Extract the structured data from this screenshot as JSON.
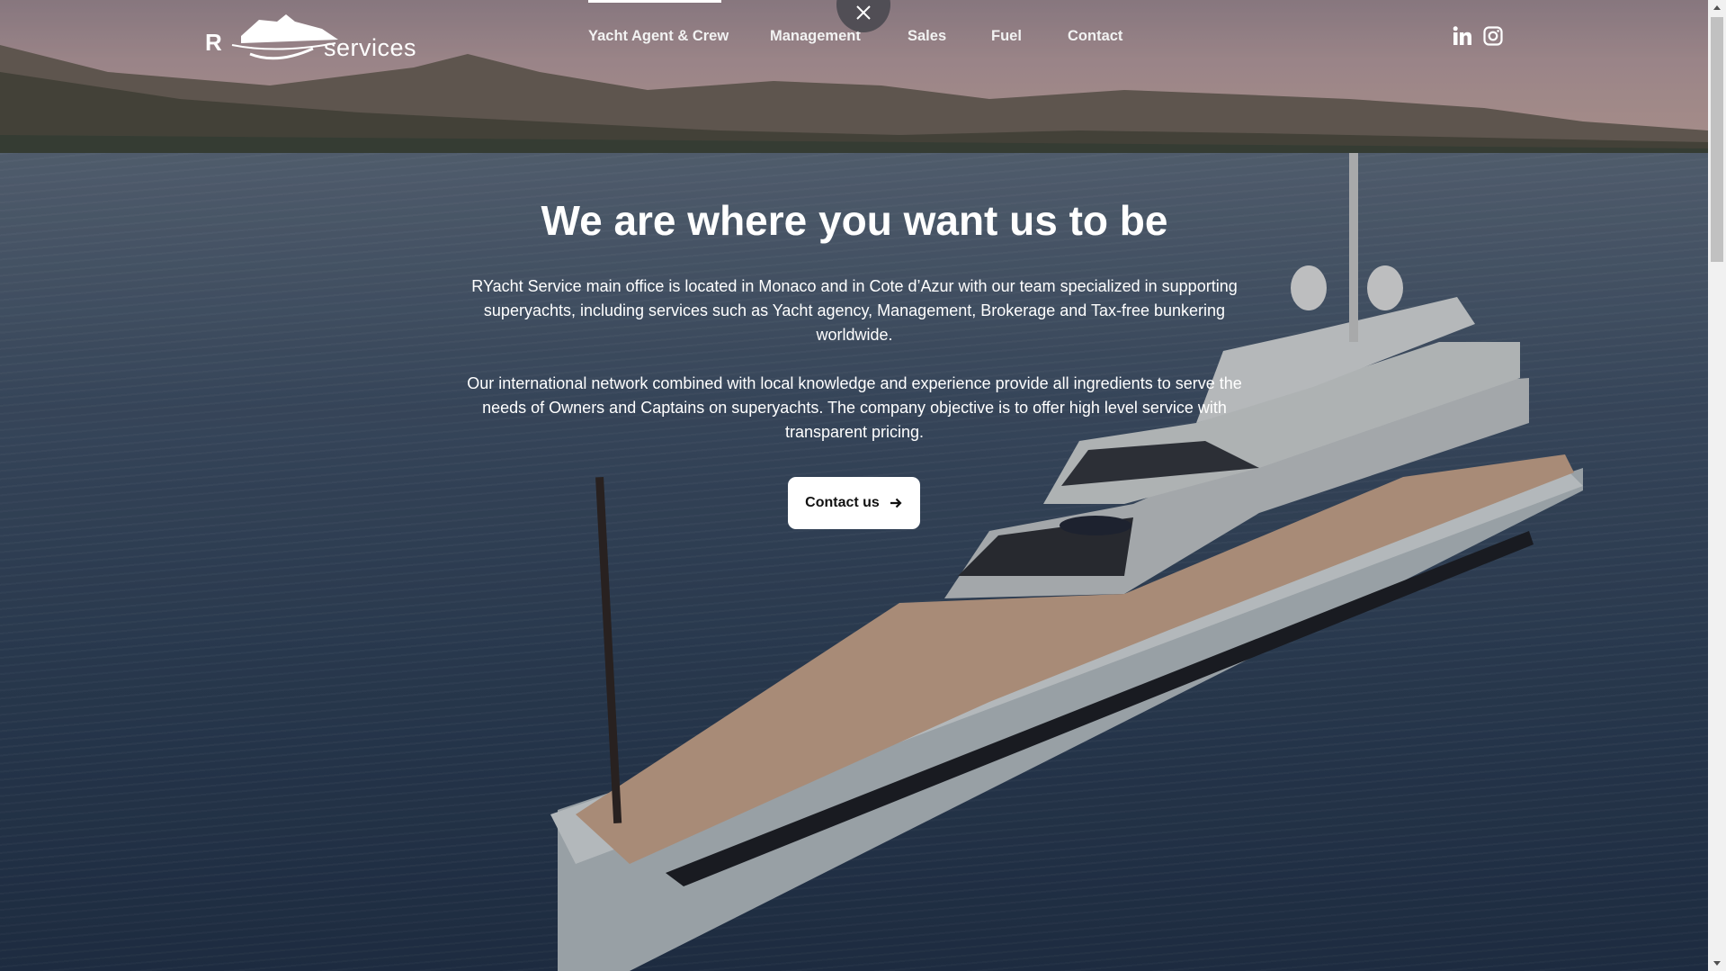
{
  "logo": {
    "left_text": "R",
    "right_text": "services"
  },
  "nav": {
    "items": [
      {
        "label": "Yacht Agent & Crew",
        "active": true
      },
      {
        "label": "Management"
      },
      {
        "label": "Sales"
      },
      {
        "label": "Fuel"
      },
      {
        "label": "Contact"
      }
    ]
  },
  "social": {
    "icons": [
      "linkedin-icon",
      "instagram-icon"
    ]
  },
  "hero": {
    "title": "We are where you want us to be",
    "paragraph1": "RYacht Service main office is located in Monaco and in Cote d’Azur with our team specialized in supporting superyachts, including services such as Yacht agency, Management, Brokerage and Tax-free bunkering worldwide.",
    "paragraph2": "Our international network combined with local knowledge and experience provide all ingredients to serve the needs of Owners and Captains on superyachts. The company objective is to offer high level service with transparent pricing.",
    "cta_label": "Contact us"
  },
  "colors": {
    "text": "#ffffff",
    "button_bg": "#ffffff",
    "button_text": "#111111",
    "close_bg": "#46464e"
  }
}
